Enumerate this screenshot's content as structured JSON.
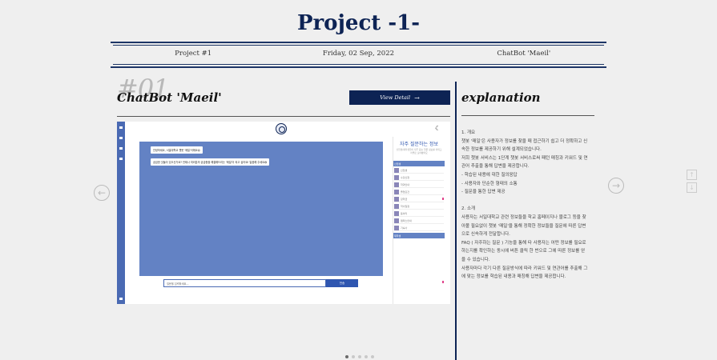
{
  "page": {
    "title": "Project -1-"
  },
  "meta": {
    "project": "Project #1",
    "date": "Friday, 02 Sep, 2022",
    "name": "ChatBot 'Maeil'"
  },
  "project": {
    "number": "#01",
    "name": "ChatBot 'Maeil'",
    "view_detail": "View Detail",
    "view_detail_icon": "arrow-right-icon"
  },
  "explanation": {
    "title": "explanation",
    "lines": [
      "1. 개요",
      "챗봇 '매일'은 사용자가 정보를 찾을 때 접근하기 쉽고 더 정확하고 신",
      "속한 정보를 제공하기 위해 설계되었습니다.",
      "저희 챗봇 서비스는 1단계 챗봇 서비스로써 패턴 매칭과 키워드 및 연",
      "관어 추출을 통해 답변을 제공합니다.",
      "- 학습된 내용에 대한 질의응답",
      "- 사용자와 단순한 형태의 소통",
      "- 질문을 통한 답변 제공",
      "",
      "2. 소개",
      "사용자는 서일대학교 관련 정보들을 학교 홈페이지나 블로그 등을 찾",
      "아볼 필요없이 챗봇 '매일'을 통해 정확한 정보들을 질문에 따른 답변",
      "으로 신속하게 전달합니다.",
      "FAQ ( 자주하는 질문 ) 기능을 통해 타 사용자는 어떤 정보를 필요로",
      "하는지를 확인하는 동시에 버튼 클릭 한 번으로 그에 따른 정보를 얻",
      "을 수 있습니다.",
      "사용자마다 각기 다른 질문방식에 따라 키워드 및 연관어를 추출해 그",
      "에 맞는 정보를 학습된 내용과 매칭해 답변을 제공합니다."
    ]
  },
  "screenshot": {
    "chat_messages": [
      "안녕하세요, 서일대학교 챗봇 '매일'이에요😊",
      "궁금한 것들이 있으신가요? 언제나 여러분의 궁금증을 해결해드리는 '매일'이 되고 싶어요! 말씀해 주세요😄"
    ],
    "input_placeholder": "질문을 입력하세요...",
    "send_label": "전송",
    "faq_title": "자주 질문하는 정보",
    "faq_subtitle": "신입생/재학생들이 자주 묻는 질문 정보를 카테고리별로 모아봤어요",
    "faq_header": "신입생",
    "faq_items": [
      "신입생",
      "수강신청",
      "학과안내",
      "졸업요건",
      "장학금",
      "학사일정",
      "동아리",
      "캠퍼스안내",
      "기숙사"
    ],
    "faq_footer": "재학생"
  },
  "carousel": {
    "slides": 5,
    "active": 0
  }
}
